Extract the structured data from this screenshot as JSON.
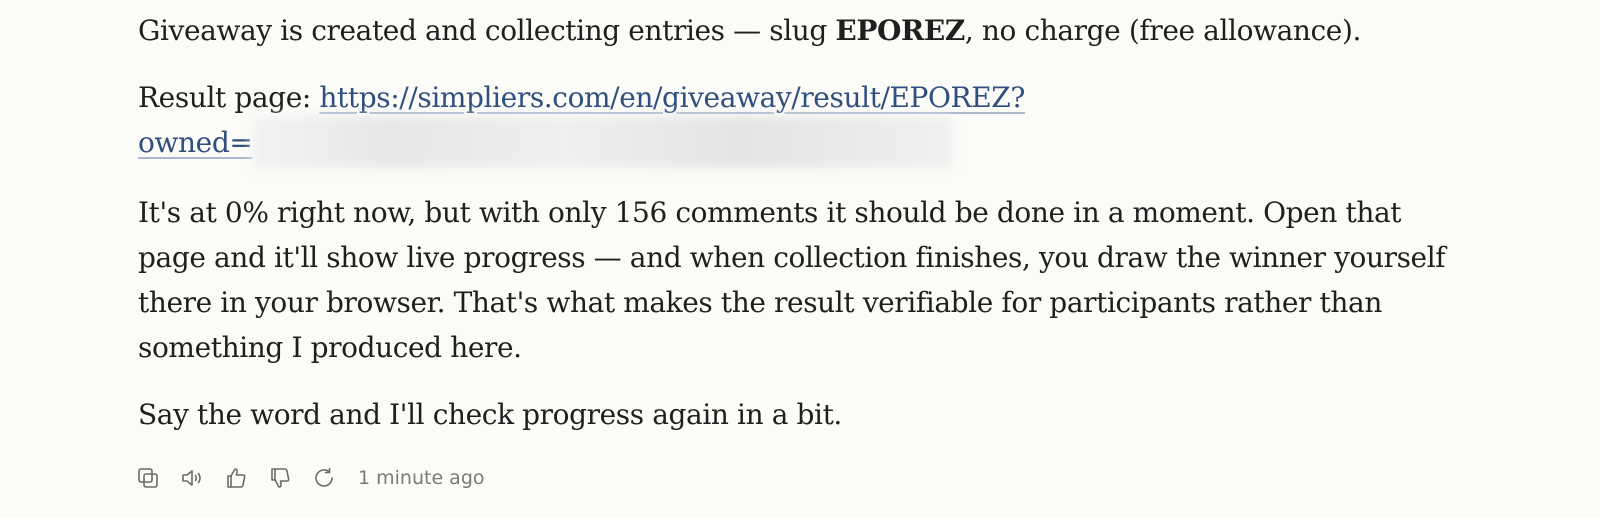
{
  "message": {
    "p1": {
      "before": "Giveaway is created and collecting entries — slug ",
      "slug": "EPOREZ",
      "after": ", no charge (free allowance)."
    },
    "p2": {
      "label": "Result page: ",
      "link_text": "https://simpliers.com/en/giveaway/result/EPOREZ?owned="
    },
    "p3": "It's at 0% right now, but with only 156 comments it should be done in a moment. Open that page and it'll show live progress — and when collection finishes, you draw the winner yourself there in your browser. That's what makes the result verifiable for participants rather than something I produced here.",
    "p4": "Say the word and I'll check progress again in a bit."
  },
  "actions": {
    "icons": [
      "copy-icon",
      "speaker-icon",
      "thumbs-up-icon",
      "thumbs-down-icon",
      "retry-icon"
    ],
    "timestamp": "1 minute ago"
  }
}
